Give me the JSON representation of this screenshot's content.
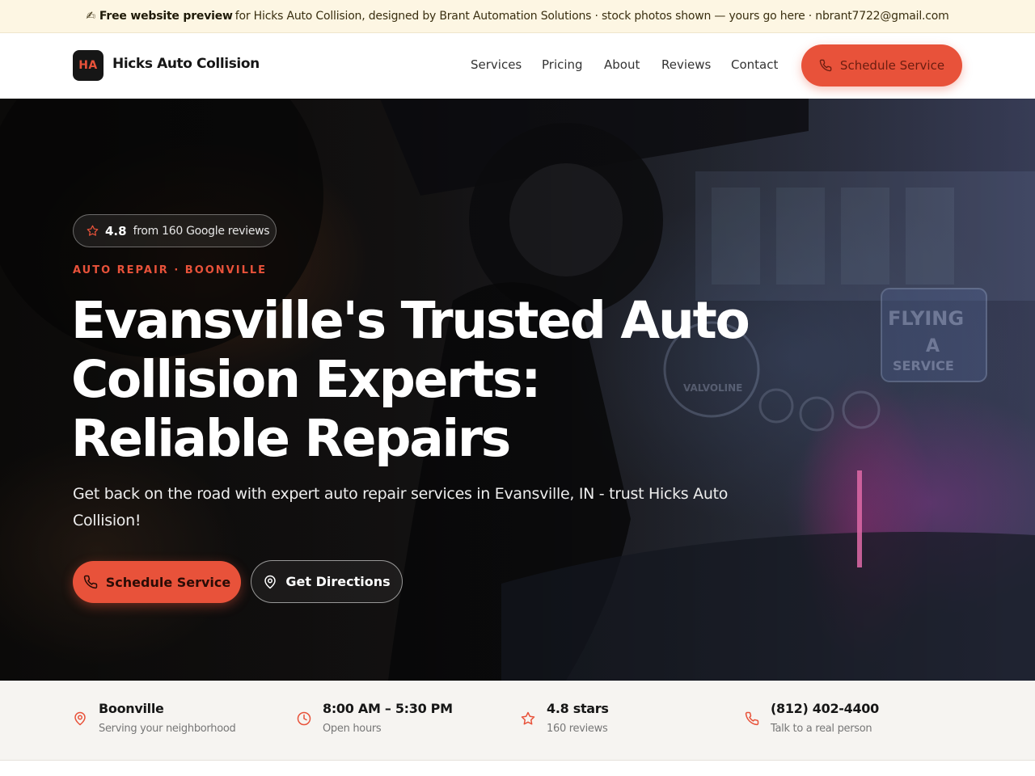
{
  "announcement": {
    "emoji": "✍",
    "bold": "Free website preview",
    "text": "for Hicks Auto Collision, designed by Brant Automation Solutions · stock photos shown — yours go here · nbrant7722@gmail.com"
  },
  "header": {
    "logo_initials": "HA",
    "brand": "Hicks Auto Collision",
    "nav": [
      "Services",
      "Pricing",
      "About",
      "Reviews",
      "Contact"
    ],
    "cta_label": "Schedule Service"
  },
  "hero": {
    "rating_value": "4.8",
    "rating_text": "from 160 Google reviews",
    "eyebrow": "AUTO REPAIR · BOONVILLE",
    "headline_lines": [
      "Evansville's Trusted Auto",
      "Collision Experts:",
      "Reliable Repairs"
    ],
    "subhead": "Get back on the road with expert auto repair services in Evansville, IN - trust Hicks Auto Collision!",
    "primary_cta": "Schedule Service",
    "secondary_cta": "Get Directions",
    "sign_text": [
      "FLYING",
      "A",
      "SERVICE"
    ],
    "sign2_text": "VALVOLINE"
  },
  "info_strip": [
    {
      "icon": "map-pin-icon",
      "title": "Boonville",
      "sub": "Serving your neighborhood"
    },
    {
      "icon": "clock-icon",
      "title": "8:00 AM – 5:30 PM",
      "sub": "Open hours"
    },
    {
      "icon": "star-icon",
      "title": "4.8 stars",
      "sub": "160 reviews"
    },
    {
      "icon": "phone-icon",
      "title": "(812) 402-4400",
      "sub": "Talk to a real person"
    }
  ],
  "colors": {
    "accent": "#e8523a",
    "announce_bg": "#fdf6e3",
    "strip_bg": "#f6f4f1",
    "dark": "#161616"
  }
}
